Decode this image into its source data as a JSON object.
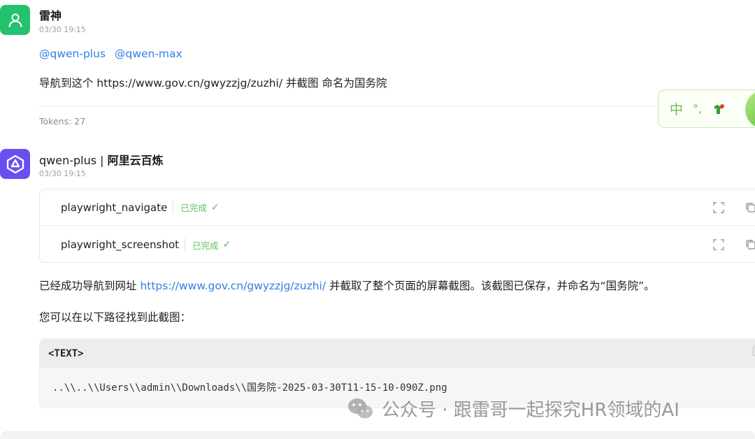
{
  "user_message": {
    "name": "雷神",
    "time": "03/30 19:15",
    "mentions": [
      "@qwen-plus",
      "@qwen-max"
    ],
    "text": "导航到这个 https://www.gov.cn/gwyzzjg/zuzhi/ 并截图 命名为国务院",
    "tokens": "Tokens: 27"
  },
  "ime": {
    "mode": "中",
    "punct": "°,"
  },
  "ai_message": {
    "name_model": "qwen-plus",
    "name_sep": " | ",
    "name_provider": "阿里云百炼",
    "time": "03/30 19:15",
    "tools": [
      {
        "name": "playwright_navigate",
        "status": "已完成",
        "check": "✓"
      },
      {
        "name": "playwright_screenshot",
        "status": "已完成",
        "check": "✓"
      }
    ],
    "reply_before": "已经成功导航到网址 ",
    "reply_link": "https://www.gov.cn/gwyzzjg/zuzhi/",
    "reply_after": " 并截取了整个页面的屏幕截图。该截图已保存，并命名为“国务院”。",
    "reply2": "您可以在以下路径找到此截图：",
    "code_lang": "<TEXT>",
    "code_text": "..\\\\..\\\\Users\\\\admin\\\\Downloads\\\\国务院-2025-03-30T11-15-10-090Z.png"
  },
  "watermark": "公众号 · 跟雷哥一起探究HR领域的AI",
  "colors": {
    "user_avatar": "#24c26e",
    "ai_avatar": "#6a4ff0",
    "link": "#2f7fe6",
    "success": "#58bf5b"
  }
}
